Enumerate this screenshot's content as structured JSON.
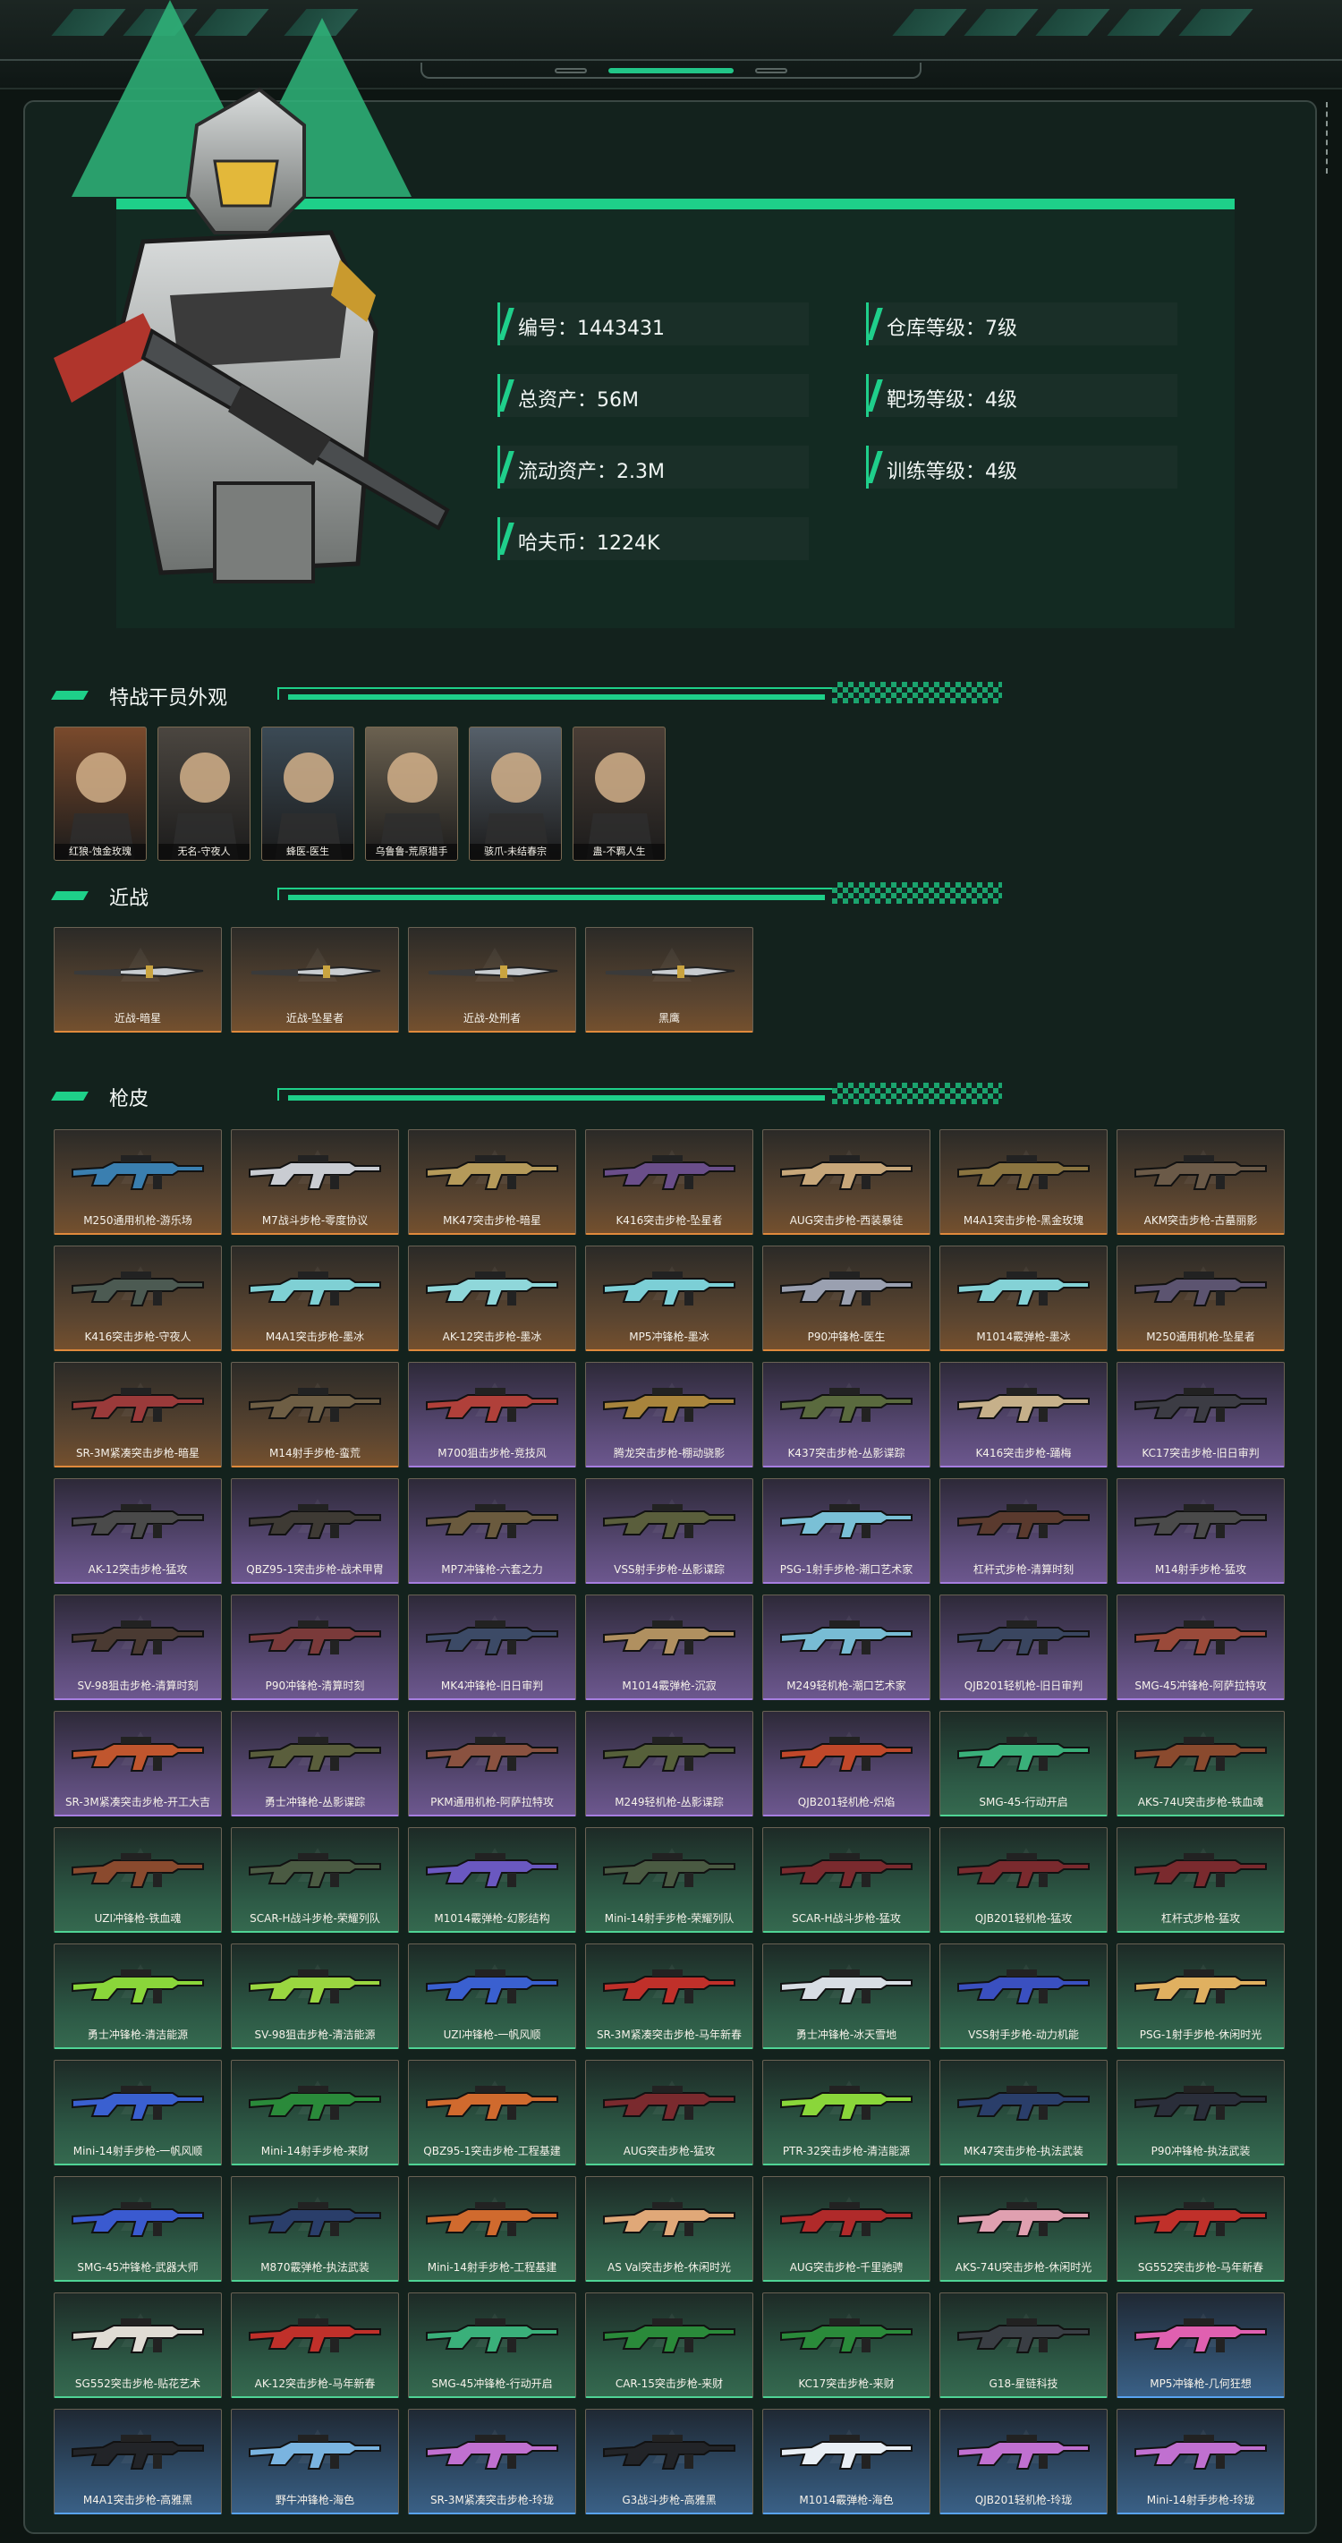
{
  "profile": {
    "stats": [
      {
        "label": "编号：1443431"
      },
      {
        "label": "仓库等级：7级"
      },
      {
        "label": "总资产：56M"
      },
      {
        "label": "靶场等级：4级"
      },
      {
        "label": "流动资产：2.3M"
      },
      {
        "label": "训练等级：4级"
      },
      {
        "label": "哈夫币：1224K"
      }
    ]
  },
  "sections": {
    "operators": "特战干员外观",
    "melee": "近战",
    "skins": "枪皮"
  },
  "operators": [
    {
      "label": "红狼-蚀金玫瑰",
      "color": "#7a4a2c"
    },
    {
      "label": "无名-守夜人",
      "color": "#4b4640"
    },
    {
      "label": "蜂医-医生",
      "color": "#3b4a55"
    },
    {
      "label": "乌鲁鲁-荒原猎手",
      "color": "#6b6150"
    },
    {
      "label": "骇爪-未结春宗",
      "color": "#56606a"
    },
    {
      "label": "蛊-不羁人生",
      "color": "#4a3e36"
    }
  ],
  "melee": [
    {
      "label": "近战-暗星",
      "rarity": "gold"
    },
    {
      "label": "近战-坠星者",
      "rarity": "gold"
    },
    {
      "label": "近战-处刑者",
      "rarity": "gold"
    },
    {
      "label": "黑鹰",
      "rarity": "gold"
    }
  ],
  "skins": [
    {
      "label": "M250通用机枪-游乐场",
      "rarity": "gold",
      "color": "#3a7fb0"
    },
    {
      "label": "M7战斗步枪-零度协议",
      "rarity": "gold",
      "color": "#c9ccd2"
    },
    {
      "label": "MK47突击步枪-暗星",
      "rarity": "gold",
      "color": "#b59a5a"
    },
    {
      "label": "K416突击步枪-坠星者",
      "rarity": "gold",
      "color": "#6a4e8a"
    },
    {
      "label": "AUG突击步枪-西装暴徒",
      "rarity": "gold",
      "color": "#c7a77a"
    },
    {
      "label": "M4A1突击步枪-黑金玫瑰",
      "rarity": "gold",
      "color": "#8a7440"
    },
    {
      "label": "AKM突击步枪-古墓丽影",
      "rarity": "gold",
      "color": "#6b5a48"
    },
    {
      "label": "K416突击步枪-守夜人",
      "rarity": "gold",
      "color": "#4c5a52"
    },
    {
      "label": "M4A1突击步枪-墨冰",
      "rarity": "gold",
      "color": "#7fd0d4"
    },
    {
      "label": "AK-12突击步枪-墨冰",
      "rarity": "gold",
      "color": "#8fd7da"
    },
    {
      "label": "MP5冲锋枪-墨冰",
      "rarity": "gold",
      "color": "#7ccfd6"
    },
    {
      "label": "P90冲锋枪-医生",
      "rarity": "gold",
      "color": "#9aa0b0"
    },
    {
      "label": "M1014霰弹枪-墨冰",
      "rarity": "gold",
      "color": "#84d2d6"
    },
    {
      "label": "M250通用机枪-坠星者",
      "rarity": "gold",
      "color": "#5c5470"
    },
    {
      "label": "SR-3M紧凑突击步枪-暗星",
      "rarity": "gold",
      "color": "#9a3a3a"
    },
    {
      "label": "M14射手步枪-蛮荒",
      "rarity": "gold",
      "color": "#6e5e44"
    },
    {
      "label": "M700狙击步枪-竞技风",
      "rarity": "purple",
      "color": "#b0403a"
    },
    {
      "label": "腾龙突击步枪-棚动骁影",
      "rarity": "purple",
      "color": "#a8843c"
    },
    {
      "label": "K437突击步枪-丛影谍踪",
      "rarity": "purple",
      "color": "#5a6a3e"
    },
    {
      "label": "K416突击步枪-踊梅",
      "rarity": "purple",
      "color": "#c6b08a"
    },
    {
      "label": "KC17突击步枪-旧日审判",
      "rarity": "purple",
      "color": "#3c3c44"
    },
    {
      "label": "AK-12突击步枪-猛攻",
      "rarity": "purple",
      "color": "#4a4a4a"
    },
    {
      "label": "QBZ95-1突击步枪-战术甲胄",
      "rarity": "purple",
      "color": "#3e3a34"
    },
    {
      "label": "MP7冲锋枪-六套之力",
      "rarity": "purple",
      "color": "#6a5a3e"
    },
    {
      "label": "VSS射手步枪-丛影谍踪",
      "rarity": "purple",
      "color": "#5a5e3c"
    },
    {
      "label": "PSG-1射手步枪-潮口艺术家",
      "rarity": "purple",
      "color": "#7ac0d6"
    },
    {
      "label": "杠杆式步枪-清算时刻",
      "rarity": "purple",
      "color": "#5a3a2e"
    },
    {
      "label": "M14射手步枪-猛攻",
      "rarity": "purple",
      "color": "#4a4a4a"
    },
    {
      "label": "SV-98狙击步枪-清算时刻",
      "rarity": "purple",
      "color": "#4a3a32"
    },
    {
      "label": "P90冲锋枪-清算时刻",
      "rarity": "purple",
      "color": "#7a3a3a"
    },
    {
      "label": "MK4冲锋枪-旧日审判",
      "rarity": "purple",
      "color": "#3c4a66"
    },
    {
      "label": "M1014霰弹枪-沉寂",
      "rarity": "purple",
      "color": "#b09060"
    },
    {
      "label": "M249轻机枪-潮口艺术家",
      "rarity": "purple",
      "color": "#78bcd4"
    },
    {
      "label": "QJB201轻机枪-旧日审判",
      "rarity": "purple",
      "color": "#3a4660"
    },
    {
      "label": "SMG-45冲锋枪-阿萨拉特攻",
      "rarity": "purple",
      "color": "#9a4a3a"
    },
    {
      "label": "SR-3M紧凑突击步枪-开工大吉",
      "rarity": "purple",
      "color": "#c0562e"
    },
    {
      "label": "勇士冲锋枪-丛影谍踪",
      "rarity": "purple",
      "color": "#5a5e3c"
    },
    {
      "label": "PKM通用机枪-阿萨拉特攻",
      "rarity": "purple",
      "color": "#8a5240"
    },
    {
      "label": "M249轻机枪-丛影谍踪",
      "rarity": "purple",
      "color": "#56603a"
    },
    {
      "label": "QJB201轻机枪-炽焰",
      "rarity": "purple",
      "color": "#c0482a"
    },
    {
      "label": "SMG-45-行动开启",
      "rarity": "green",
      "color": "#3ab07a"
    },
    {
      "label": "AKS-74U突击步枪-铁血魂",
      "rarity": "green",
      "color": "#8a4a2e"
    },
    {
      "label": "UZI冲锋枪-铁血魂",
      "rarity": "green",
      "color": "#8a4a2e"
    },
    {
      "label": "SCAR-H战斗步枪-荣耀列队",
      "rarity": "green",
      "color": "#4a5a42"
    },
    {
      "label": "M1014霰弹枪-幻影结构",
      "rarity": "green",
      "color": "#6a58c0"
    },
    {
      "label": "Mini-14射手步枪-荣耀列队",
      "rarity": "green",
      "color": "#4a5a42"
    },
    {
      "label": "SCAR-H战斗步枪-猛攻",
      "rarity": "green",
      "color": "#7a2a2e"
    },
    {
      "label": "QJB201轻机枪-猛攻",
      "rarity": "green",
      "color": "#7a2a2e"
    },
    {
      "label": "杠杆式步枪-猛攻",
      "rarity": "green",
      "color": "#7a2a2e"
    },
    {
      "label": "勇士冲锋枪-清洁能源",
      "rarity": "green",
      "color": "#8ad63a"
    },
    {
      "label": "SV-98狙击步枪-清洁能源",
      "rarity": "green",
      "color": "#9ad640"
    },
    {
      "label": "UZI冲锋枪-一帆风顺",
      "rarity": "green",
      "color": "#3a60d0"
    },
    {
      "label": "SR-3M紧凑突击步枪-马年新春",
      "rarity": "green",
      "color": "#c0302a"
    },
    {
      "label": "勇士冲锋枪-冰天雪地",
      "rarity": "green",
      "color": "#d8dde4"
    },
    {
      "label": "VSS射手步枪-动力机能",
      "rarity": "green",
      "color": "#3a50c0"
    },
    {
      "label": "PSG-1射手步枪-休闲时光",
      "rarity": "green",
      "color": "#e0b060"
    },
    {
      "label": "Mini-14射手步枪-一帆风顺",
      "rarity": "green",
      "color": "#3a60d0"
    },
    {
      "label": "Mini-14射手步枪-来财",
      "rarity": "green",
      "color": "#2a8a3a"
    },
    {
      "label": "QBZ95-1突击步枪-工程基建",
      "rarity": "green",
      "color": "#d06a2e"
    },
    {
      "label": "AUG突击步枪-猛攻",
      "rarity": "green",
      "color": "#7a2a2e"
    },
    {
      "label": "PTR-32突击步枪-清洁能源",
      "rarity": "green",
      "color": "#8ad63a"
    },
    {
      "label": "MK47突击步枪-执法武装",
      "rarity": "green",
      "color": "#2a3e6a"
    },
    {
      "label": "P90冲锋枪-执法武装",
      "rarity": "green",
      "color": "#2a2e3a"
    },
    {
      "label": "SMG-45冲锋枪-武器大师",
      "rarity": "green",
      "color": "#3a5ad0"
    },
    {
      "label": "M870霰弹枪-执法武装",
      "rarity": "green",
      "color": "#2a3e6a"
    },
    {
      "label": "Mini-14射手步枪-工程基建",
      "rarity": "green",
      "color": "#d06a2e"
    },
    {
      "label": "AS Val突击步枪-休闲时光",
      "rarity": "green",
      "color": "#e0a878"
    },
    {
      "label": "AUG突击步枪-千里驰骋",
      "rarity": "green",
      "color": "#b02a2a"
    },
    {
      "label": "AKS-74U突击步枪-休闲时光",
      "rarity": "green",
      "color": "#e0a0b0"
    },
    {
      "label": "SG552突击步枪-马年新春",
      "rarity": "green",
      "color": "#c0302a"
    },
    {
      "label": "SG552突击步枪-贴花艺术",
      "rarity": "green",
      "color": "#e0dcd4"
    },
    {
      "label": "AK-12突击步枪-马年新春",
      "rarity": "green",
      "color": "#c0302a"
    },
    {
      "label": "SMG-45冲锋枪-行动开启",
      "rarity": "green",
      "color": "#3ab07a"
    },
    {
      "label": "CAR-15突击步枪-来财",
      "rarity": "green",
      "color": "#2a8a3a"
    },
    {
      "label": "KC17突击步枪-来财",
      "rarity": "green",
      "color": "#2a8a3a"
    },
    {
      "label": "G18-星链科技",
      "rarity": "green",
      "color": "#3a3e44"
    },
    {
      "label": "MP5冲锋枪-几何狂想",
      "rarity": "blue",
      "color": "#e060b0"
    },
    {
      "label": "M4A1突击步枪-高雅黑",
      "rarity": "blue",
      "color": "#222428"
    },
    {
      "label": "野牛冲锋枪-海色",
      "rarity": "blue",
      "color": "#7ab4e0"
    },
    {
      "label": "SR-3M紧凑突击步枪-玲珑",
      "rarity": "blue",
      "color": "#c070d0"
    },
    {
      "label": "G3战斗步枪-高雅黑",
      "rarity": "blue",
      "color": "#222428"
    },
    {
      "label": "M1014霰弹枪-海色",
      "rarity": "blue",
      "color": "#e8eef4"
    },
    {
      "label": "QJB201轻机枪-玲珑",
      "rarity": "blue",
      "color": "#c070d0"
    },
    {
      "label": "Mini-14射手步枪-玲珑",
      "rarity": "blue",
      "color": "#c070d0"
    }
  ]
}
